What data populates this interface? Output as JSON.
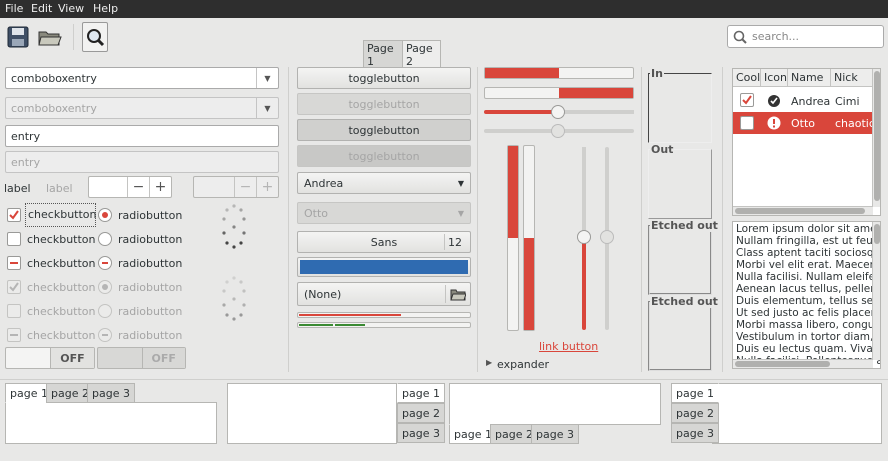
{
  "menu": [
    "File",
    "Edit",
    "View",
    "Help"
  ],
  "search": {
    "placeholder": "search..."
  },
  "stack": [
    "Page 1",
    "Page 2"
  ],
  "col1": {
    "combo1": "comboboxentry",
    "combo2": "comboboxentry",
    "entry1": "entry",
    "entry2": "entry",
    "label1": "label",
    "label2": "label",
    "checks": [
      "checkbutton",
      "checkbutton",
      "checkbutton",
      "checkbutton",
      "checkbutton",
      "checkbutton"
    ],
    "radios": [
      "radiobutton",
      "radiobutton",
      "radiobutton",
      "radiobutton",
      "radiobutton",
      "radiobutton"
    ],
    "switch_off": "OFF",
    "switch_off2": "OFF"
  },
  "col2": {
    "toggles": [
      "togglebutton",
      "togglebutton",
      "togglebutton",
      "togglebutton"
    ],
    "combo1": "Andrea",
    "combo2": "Otto",
    "font": "Sans",
    "font_size": "12",
    "file": "(None)"
  },
  "col3": {
    "link": "link button",
    "expander": "expander",
    "progress_h1": 0.5,
    "progress_h2": 0.5,
    "scale_h": 0.5
  },
  "frames": [
    "In",
    "Out",
    "Etched out",
    "Etched out"
  ],
  "tree": {
    "headers": [
      "Cool",
      "Icon",
      "Name",
      "Nick"
    ],
    "rows": [
      {
        "name": "Andrea",
        "nick": "Cimi"
      },
      {
        "name": "Otto",
        "nick": "chaotic"
      }
    ]
  },
  "text_lines": [
    "Lorem ipsum dolor sit amet, c",
    "Nullam fringilla, est ut feugiat",
    "Class aptent taciti sociosqu a",
    "Morbi vel elit erat. Maecenas",
    "Nulla facilisi. Nullam eleifend l",
    "Aenean lacus tellus, pellente",
    "Duis elementum, tellus sed tri",
    "Ut sed justo ac felis placerat",
    "Morbi massa libero, congue v",
    "Vestibulum in tortor diam, qui",
    "Duis eu lectus quam. Vivamu",
    "Nulla facilisi. Pellentesque at"
  ],
  "notebooks": {
    "nb1": [
      "page 1",
      "page 2",
      "page 3"
    ],
    "nb2": [
      "page 1",
      "page 2",
      "page 3"
    ],
    "nb3": [
      "page 1",
      "page 2",
      "page 3"
    ],
    "nb4": [
      "page 1",
      "page 2",
      "page 3"
    ]
  },
  "colors": {
    "accent": "#d9463b",
    "blue": "#2f6bb1"
  }
}
